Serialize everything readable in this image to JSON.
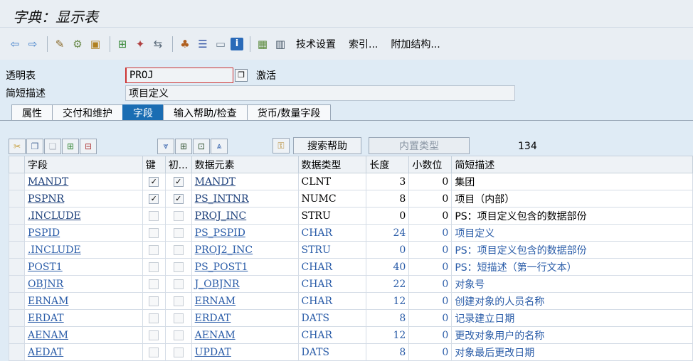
{
  "title": "字典：显示表",
  "toolbar": {
    "icons": [
      "back-icon",
      "forward-icon",
      "other-object-icon",
      "display-change-icon",
      "activate-icon",
      "where-used-icon",
      "check-icon",
      "transport-icon",
      "hierarchy-icon",
      "layout-icon",
      "object-list-icon",
      "info-icon",
      "grid-icon",
      "table-icon"
    ],
    "tech_settings": "技术设置",
    "index": "索引...",
    "append": "附加结构..."
  },
  "fields": {
    "table_label": "透明表",
    "table_value": "PROJ",
    "status": "激活",
    "desc_label": "简短描述",
    "desc_value": "项目定义"
  },
  "tabs": [
    "属性",
    "交付和维护",
    "字段",
    "输入帮助/检查",
    "货币/数量字段"
  ],
  "active_tab": 2,
  "grid_toolbar": {
    "search_help": "搜索帮助",
    "builtin_type": "内置类型",
    "count": "134"
  },
  "columns": [
    "字段",
    "键",
    "初...",
    "数据元素",
    "数据类型",
    "长度",
    "小数位",
    "简短描述"
  ],
  "rows": [
    {
      "field": "MANDT",
      "key": true,
      "init": true,
      "elem": "MANDT",
      "type": "CLNT",
      "len": "3",
      "dec": "0",
      "desc": "集团",
      "style": "black"
    },
    {
      "field": "PSPNR",
      "key": true,
      "init": true,
      "elem": "PS_INTNR",
      "type": "NUMC",
      "len": "8",
      "dec": "0",
      "desc": "项目（内部）",
      "style": "black"
    },
    {
      "field": ".INCLUDE",
      "key": false,
      "init": false,
      "elem": "PROJ_INC",
      "type": "STRU",
      "len": "0",
      "dec": "0",
      "desc": "PS：项目定义包含的数据部份",
      "style": "black"
    },
    {
      "field": "PSPID",
      "key": false,
      "init": false,
      "elem": "PS_PSPID",
      "type": "CHAR",
      "len": "24",
      "dec": "0",
      "desc": "项目定义",
      "style": "blue"
    },
    {
      "field": ".INCLUDE",
      "key": false,
      "init": false,
      "elem": "PROJ2_INC",
      "type": "STRU",
      "len": "0",
      "dec": "0",
      "desc": "PS：项目定义包含的数据部份",
      "style": "blue"
    },
    {
      "field": "POST1",
      "key": false,
      "init": false,
      "elem": "PS_POST1",
      "type": "CHAR",
      "len": "40",
      "dec": "0",
      "desc": "PS：短描述（第一行文本）",
      "style": "blue"
    },
    {
      "field": "OBJNR",
      "key": false,
      "init": false,
      "elem": "J_OBJNR",
      "type": "CHAR",
      "len": "22",
      "dec": "0",
      "desc": "对象号",
      "style": "blue"
    },
    {
      "field": "ERNAM",
      "key": false,
      "init": false,
      "elem": "ERNAM",
      "type": "CHAR",
      "len": "12",
      "dec": "0",
      "desc": "创建对象的人员名称",
      "style": "blue"
    },
    {
      "field": "ERDAT",
      "key": false,
      "init": false,
      "elem": "ERDAT",
      "type": "DATS",
      "len": "8",
      "dec": "0",
      "desc": "记录建立日期",
      "style": "blue"
    },
    {
      "field": "AENAM",
      "key": false,
      "init": false,
      "elem": "AENAM",
      "type": "CHAR",
      "len": "12",
      "dec": "0",
      "desc": "更改对象用户的名称",
      "style": "blue"
    },
    {
      "field": "AEDAT",
      "key": false,
      "init": false,
      "elem": "UPDAT",
      "type": "DATS",
      "len": "8",
      "dec": "0",
      "desc": "对象最后更改日期",
      "style": "blue"
    }
  ]
}
